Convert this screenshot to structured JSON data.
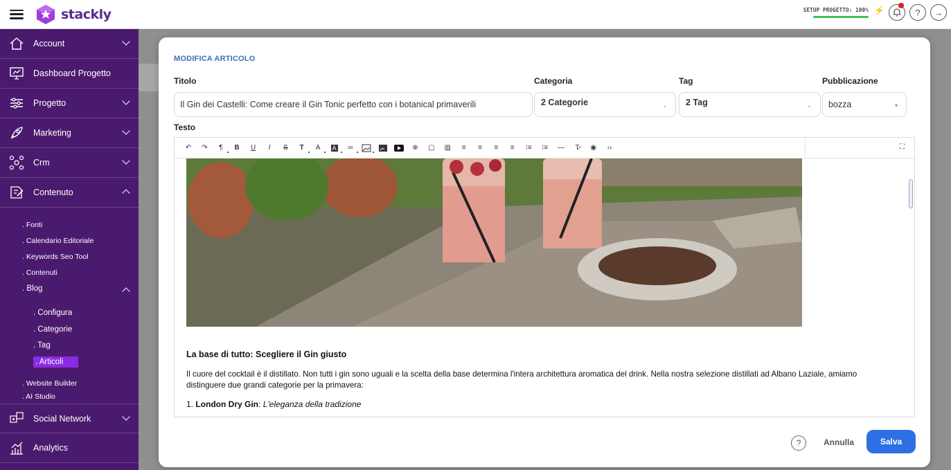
{
  "brand": {
    "name": "stackly"
  },
  "topbar": {
    "setup_label": "SETUP PROGETTO: 100%"
  },
  "sidebar": {
    "items": [
      {
        "label": "Account",
        "icon": "home-icon"
      },
      {
        "label": "Dashboard Progetto",
        "icon": "dashboard-icon"
      },
      {
        "label": "Progetto",
        "icon": "sliders-icon"
      },
      {
        "label": "Marketing",
        "icon": "rocket-icon"
      },
      {
        "label": "Crm",
        "icon": "network-icon"
      },
      {
        "label": "Contenuto",
        "icon": "edit-icon"
      },
      {
        "label": "Social Network",
        "icon": "social-icon"
      },
      {
        "label": "Analytics",
        "icon": "chart-icon"
      }
    ],
    "contenuto_sub": [
      ". Fonti",
      ". Calendario Editoriale",
      ". Keywords Seo Tool",
      ". Contenuti",
      ". Blog"
    ],
    "blog_sub": [
      ". Configura",
      ". Categorie",
      ". Tag",
      ". Articoli"
    ],
    "contenuto_sub_after": [
      ". Website Builder",
      ". AI Studio"
    ]
  },
  "modal": {
    "title": "MODIFICA ARTICOLO",
    "labels": {
      "titolo": "Titolo",
      "categoria": "Categoria",
      "tag": "Tag",
      "pubblicazione": "Pubblicazione",
      "testo": "Testo"
    },
    "titolo_value": "Il Gin dei Castelli: Come creare il Gin Tonic perfetto con i botanical primaverili",
    "categoria_value": "2 Categorie",
    "tag_value": "2 Tag",
    "pubblicazione_value": "bozza",
    "annulla": "Annulla",
    "salva": "Salva"
  },
  "content": {
    "heading": "La base di tutto: Scegliere il Gin giusto",
    "paragraph": "Il cuore del cocktail è il distillato. Non tutti i gin sono uguali e la scelta della base determina l'intera architettura aromatica del drink. Nella nostra selezione distillati ad Albano Laziale, amiamo distinguere due grandi categorie per la primavera:",
    "list_num": "1.",
    "list_bold": "London Dry Gin",
    "list_sep": ": ",
    "list_italic": "L'eleganza della tradizione"
  },
  "colors": {
    "sidebar": "#4a1a6e",
    "active": "#8a2be2",
    "primary": "#2f6fe6",
    "title": "#3d6fb3"
  }
}
